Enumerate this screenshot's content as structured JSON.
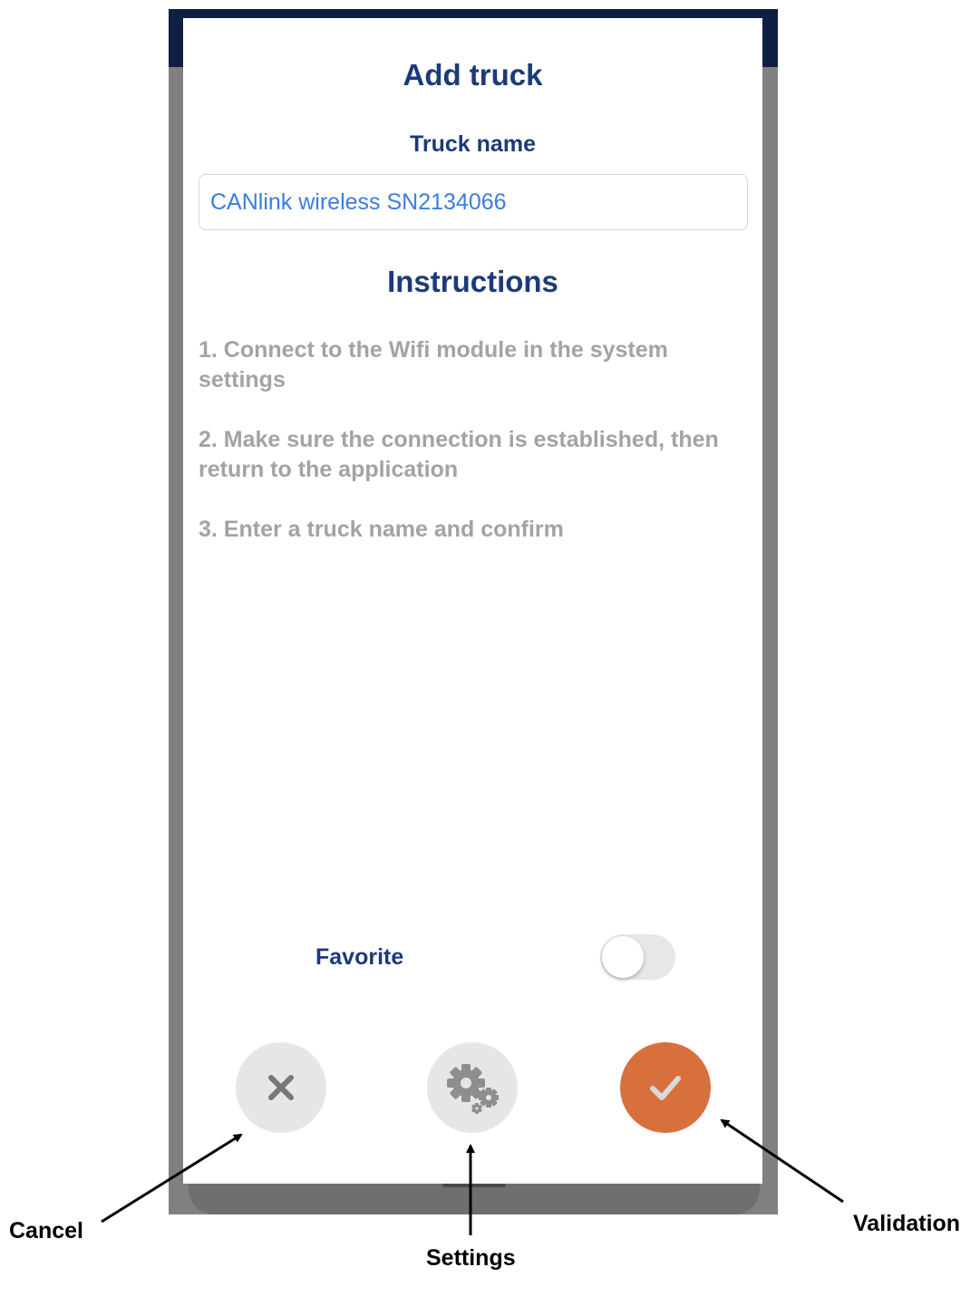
{
  "modal": {
    "title": "Add truck",
    "truck_name_label": "Truck name",
    "truck_name_value": "CANlink wireless SN2134066",
    "instructions_title": "Instructions",
    "instructions": [
      "1. Connect to the Wifi module in the system settings",
      "2. Make sure the connection is established, then return to the application",
      "3. Enter a truck name and confirm"
    ],
    "favorite_label": "Favorite",
    "favorite_on": false
  },
  "buttons": {
    "cancel_icon": "close-icon",
    "settings_icon": "gears-icon",
    "validate_icon": "checkmark-icon"
  },
  "annotations": {
    "cancel": "Cancel",
    "settings": "Settings",
    "validation": "Validation"
  },
  "colors": {
    "title": "#1b3a7a",
    "input_text": "#3a7de0",
    "instruction_text": "#a3a3a3",
    "validate_button": "#d8703d",
    "neutral_button": "#e6e6e6",
    "top_bar": "#0f1f44"
  }
}
